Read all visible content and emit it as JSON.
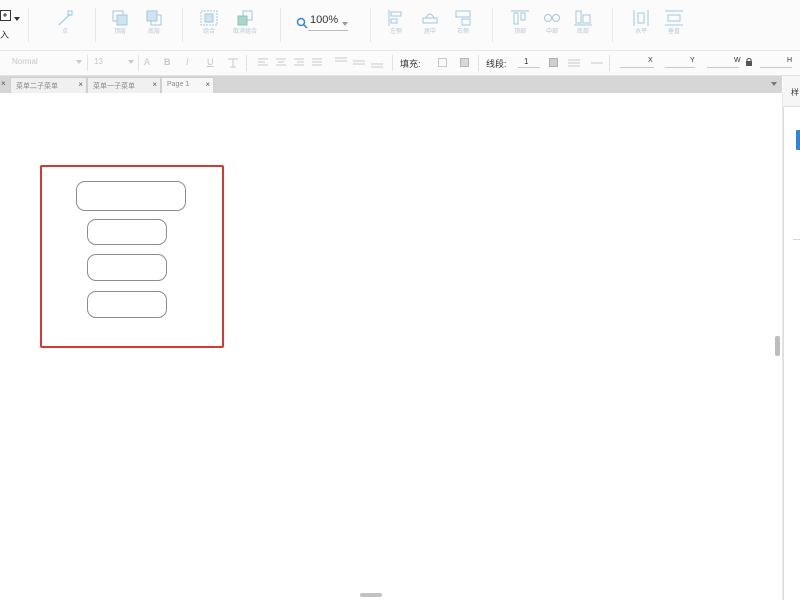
{
  "toolbar": {
    "insert_label": "入",
    "zoom_value": "100%",
    "buttons": [
      {
        "name": "anchor",
        "label": "点"
      },
      {
        "name": "top",
        "label": "顶层"
      },
      {
        "name": "bottom",
        "label": "底层"
      },
      {
        "name": "group",
        "label": "组合"
      },
      {
        "name": "ungroup",
        "label": "取消组合"
      },
      {
        "name": "align-left",
        "label": "左侧"
      },
      {
        "name": "align-center",
        "label": "居中"
      },
      {
        "name": "align-right",
        "label": "右侧"
      },
      {
        "name": "align-top",
        "label": "顶部"
      },
      {
        "name": "align-middle",
        "label": "中部"
      },
      {
        "name": "align-bottom",
        "label": "底部"
      },
      {
        "name": "distribute-h",
        "label": "水平"
      },
      {
        "name": "distribute-v",
        "label": "垂直"
      }
    ]
  },
  "format": {
    "font_family": "Normal",
    "font_size": "13",
    "fill_label": "填充:",
    "stroke_label": "线段:",
    "stroke_value": "1",
    "x_label": "X",
    "y_label": "Y",
    "w_label": "W",
    "h_label": "H"
  },
  "tabs": [
    {
      "label": "菜单二子菜单"
    },
    {
      "label": "菜单一子菜单"
    },
    {
      "label": "Page 1"
    }
  ],
  "right_panel": {
    "label": "样"
  },
  "colors": {
    "selection": "#d43a34",
    "accent": "#2f86d6",
    "icon": "#9fc7e0"
  }
}
